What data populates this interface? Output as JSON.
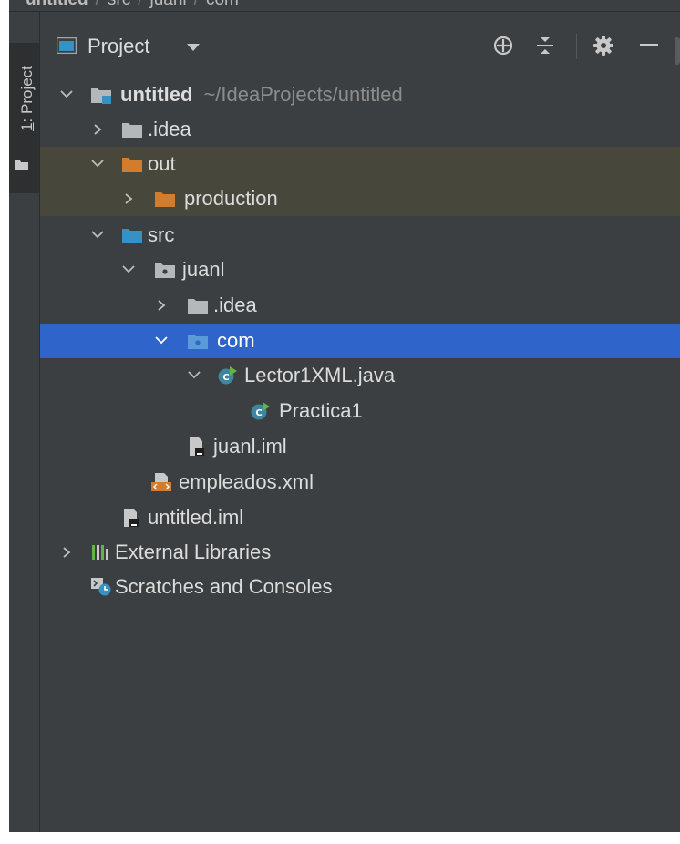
{
  "breadcrumb": {
    "items": [
      "untitled",
      "src",
      "juanl",
      "com"
    ]
  },
  "stripe": {
    "tab_number": "1",
    "tab_label": ": Project"
  },
  "toolbar": {
    "title": "Project"
  },
  "tree": {
    "root_name": "untitled",
    "root_path": "~/IdeaProjects/untitled",
    "idea": ".idea",
    "out": "out",
    "production": "production",
    "src": "src",
    "juanl": "juanl",
    "juanl_idea": ".idea",
    "com": "com",
    "lector": "Lector1XML.java",
    "practica": "Practica1",
    "juanl_iml": "juanl.iml",
    "empleados": "empleados.xml",
    "untitled_iml": "untitled.iml",
    "external_libraries": "External Libraries",
    "scratches": "Scratches and Consoles"
  },
  "colors": {
    "panel_bg": "#3c3f41",
    "selected_row": "#2f65ca",
    "excluded_row": "#48473b",
    "folder_grey": "#b4b8bb",
    "folder_source": "#3592c4",
    "folder_excluded": "#d27d2d"
  }
}
